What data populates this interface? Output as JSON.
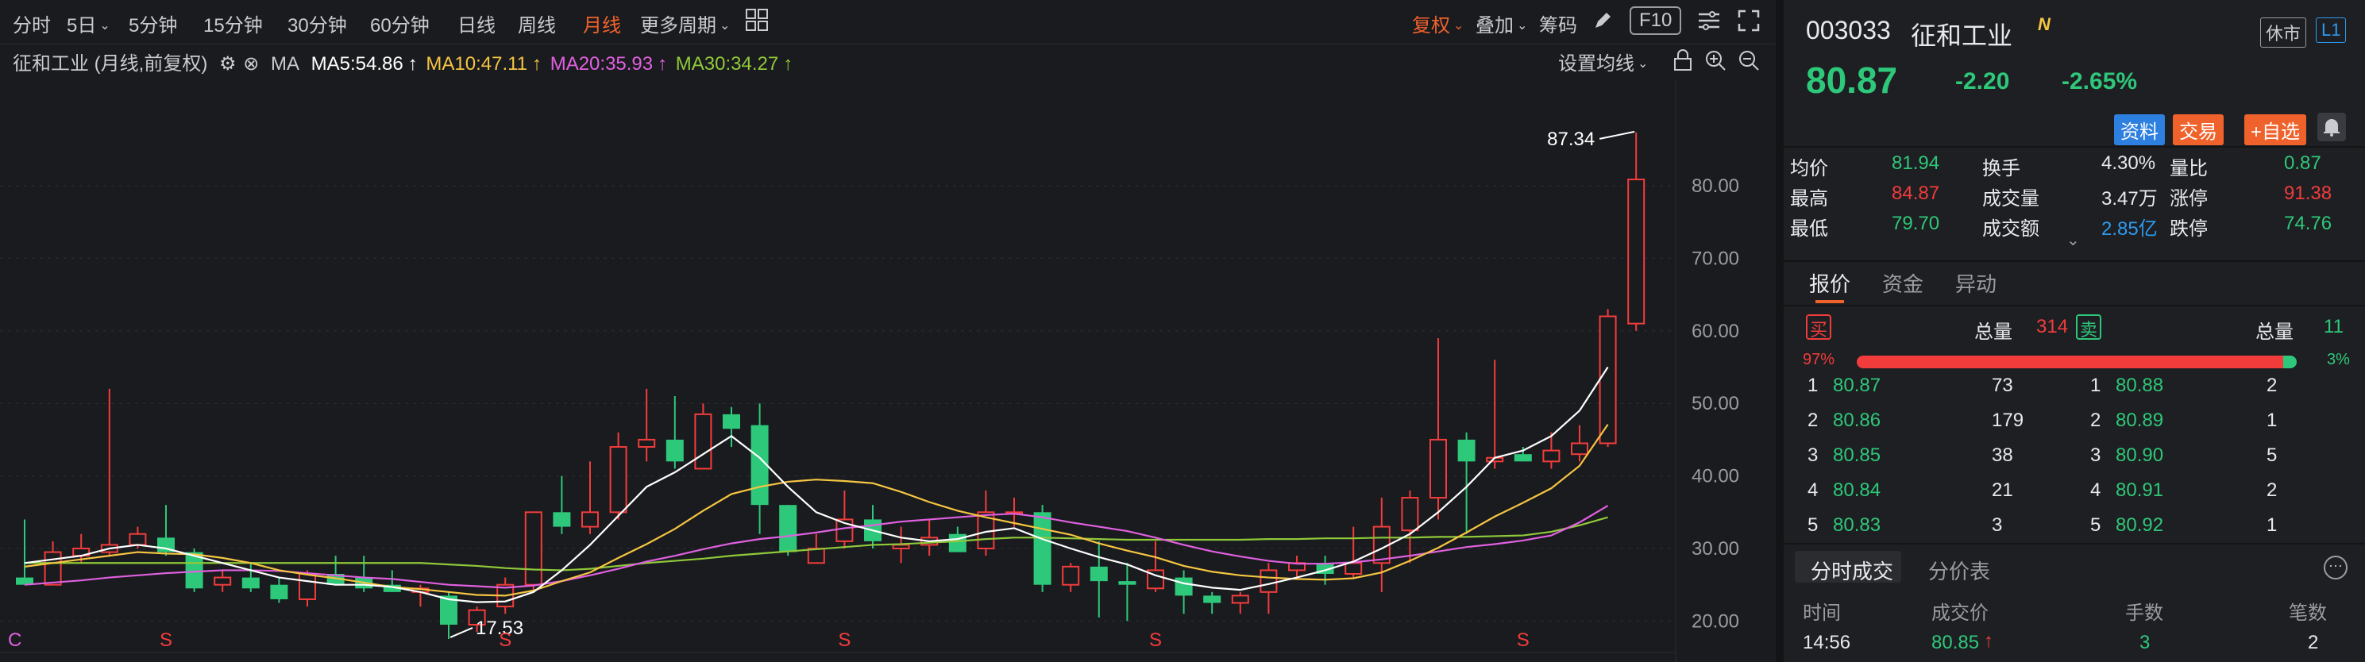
{
  "toolbar": {
    "items": [
      "分时",
      "5日",
      "5分钟",
      "15分钟",
      "30分钟",
      "60分钟",
      "日线",
      "周线",
      "月线",
      "更多周期"
    ],
    "fuquan": "复权",
    "overlay": "叠加",
    "chips": "筹码",
    "f10": "F10"
  },
  "ma_header": {
    "name": "征和工业 (月线,前复权)",
    "ma_label": "MA",
    "ma5": "MA5:54.86",
    "ma10": "MA10:47.11",
    "ma20": "MA20:35.93",
    "ma30": "MA30:34.27",
    "arrow": "↑",
    "set_ma": "设置均线",
    "colors": {
      "ma5": "#ffffff",
      "ma10": "#f5c542",
      "ma20": "#e060e0",
      "ma30": "#8fc93a"
    }
  },
  "chart_data": {
    "type": "candlestick",
    "ylim": [
      15,
      95
    ],
    "y_ticks": [
      "80.00",
      "70.00",
      "60.00",
      "50.00",
      "40.00",
      "30.00",
      "20.00"
    ],
    "y_tick_values": [
      80,
      70,
      60,
      50,
      40,
      30,
      20
    ],
    "max_label": "87.34",
    "min_label": "17.53",
    "bottom_markers": [
      {
        "label": "C",
        "i": 0
      },
      {
        "label": "S",
        "i": 5
      },
      {
        "label": "S",
        "i": 17
      },
      {
        "label": "S",
        "i": 29
      },
      {
        "label": "S",
        "i": 40
      },
      {
        "label": "S",
        "i": 53
      }
    ],
    "candles": [
      {
        "o": 26,
        "h": 34,
        "l": 25,
        "c": 25
      },
      {
        "o": 25,
        "h": 31,
        "l": 25,
        "c": 29.5
      },
      {
        "o": 29,
        "h": 32,
        "l": 28,
        "c": 30
      },
      {
        "o": 29.5,
        "h": 52,
        "l": 29,
        "c": 30.5
      },
      {
        "o": 30.5,
        "h": 33,
        "l": 30,
        "c": 32
      },
      {
        "o": 31.5,
        "h": 36,
        "l": 29,
        "c": 29.5
      },
      {
        "o": 29.5,
        "h": 30,
        "l": 24,
        "c": 24.5
      },
      {
        "o": 25,
        "h": 27,
        "l": 24,
        "c": 26
      },
      {
        "o": 26,
        "h": 28,
        "l": 24,
        "c": 24.5
      },
      {
        "o": 25,
        "h": 26,
        "l": 22.5,
        "c": 23
      },
      {
        "o": 23,
        "h": 27,
        "l": 22,
        "c": 26.5
      },
      {
        "o": 26.5,
        "h": 29,
        "l": 25,
        "c": 25
      },
      {
        "o": 26,
        "h": 29,
        "l": 24,
        "c": 24.5
      },
      {
        "o": 25,
        "h": 27,
        "l": 24,
        "c": 24
      },
      {
        "o": 24,
        "h": 25,
        "l": 22,
        "c": 24.5
      },
      {
        "o": 23.5,
        "h": 24,
        "l": 17.53,
        "c": 19.5
      },
      {
        "o": 19.5,
        "h": 22,
        "l": 18.5,
        "c": 21.5
      },
      {
        "o": 22,
        "h": 26,
        "l": 21,
        "c": 25
      },
      {
        "o": 25,
        "h": 35,
        "l": 24,
        "c": 35
      },
      {
        "o": 35,
        "h": 40,
        "l": 32,
        "c": 33
      },
      {
        "o": 33,
        "h": 42,
        "l": 32,
        "c": 35
      },
      {
        "o": 35,
        "h": 46,
        "l": 34,
        "c": 44
      },
      {
        "o": 44,
        "h": 52,
        "l": 42,
        "c": 45
      },
      {
        "o": 45,
        "h": 51,
        "l": 41,
        "c": 42
      },
      {
        "o": 41,
        "h": 50,
        "l": 41,
        "c": 48.5
      },
      {
        "o": 48.5,
        "h": 49.5,
        "l": 44,
        "c": 46.5
      },
      {
        "o": 47,
        "h": 50,
        "l": 32,
        "c": 36
      },
      {
        "o": 36,
        "h": 36,
        "l": 29,
        "c": 29.5
      },
      {
        "o": 28,
        "h": 32,
        "l": 28,
        "c": 30
      },
      {
        "o": 31,
        "h": 38,
        "l": 30,
        "c": 34
      },
      {
        "o": 34,
        "h": 36,
        "l": 30,
        "c": 31
      },
      {
        "o": 30,
        "h": 33,
        "l": 28,
        "c": 30.5
      },
      {
        "o": 30.5,
        "h": 34,
        "l": 29,
        "c": 31.5
      },
      {
        "o": 32,
        "h": 33,
        "l": 30,
        "c": 29.5
      },
      {
        "o": 30,
        "h": 38,
        "l": 29,
        "c": 35
      },
      {
        "o": 35,
        "h": 37,
        "l": 33,
        "c": 35
      },
      {
        "o": 35,
        "h": 36,
        "l": 24,
        "c": 25
      },
      {
        "o": 25,
        "h": 28,
        "l": 24,
        "c": 27.5
      },
      {
        "o": 27.5,
        "h": 31,
        "l": 20.5,
        "c": 25.5
      },
      {
        "o": 25.5,
        "h": 28,
        "l": 20,
        "c": 25
      },
      {
        "o": 24.5,
        "h": 31,
        "l": 24,
        "c": 27
      },
      {
        "o": 26,
        "h": 27,
        "l": 21,
        "c": 23.5
      },
      {
        "o": 23.5,
        "h": 24,
        "l": 21,
        "c": 22.5
      },
      {
        "o": 22.5,
        "h": 24,
        "l": 21,
        "c": 23.5
      },
      {
        "o": 24,
        "h": 28,
        "l": 21,
        "c": 27
      },
      {
        "o": 27,
        "h": 29,
        "l": 26,
        "c": 28
      },
      {
        "o": 28,
        "h": 29,
        "l": 25,
        "c": 26.5
      },
      {
        "o": 26.5,
        "h": 33,
        "l": 26,
        "c": 28
      },
      {
        "o": 28,
        "h": 37,
        "l": 24,
        "c": 33
      },
      {
        "o": 32.5,
        "h": 38,
        "l": 28,
        "c": 37
      },
      {
        "o": 37,
        "h": 59,
        "l": 34,
        "c": 45
      },
      {
        "o": 45,
        "h": 46,
        "l": 32,
        "c": 42
      },
      {
        "o": 42,
        "h": 56,
        "l": 41,
        "c": 42.5
      },
      {
        "o": 43,
        "h": 44,
        "l": 42,
        "c": 42
      },
      {
        "o": 42,
        "h": 46,
        "l": 41,
        "c": 43.5
      },
      {
        "o": 43,
        "h": 47,
        "l": 42,
        "c": 44.5
      },
      {
        "o": 44.5,
        "h": 63,
        "l": 44,
        "c": 62
      },
      {
        "o": 61,
        "h": 87.34,
        "l": 60,
        "c": 80.87
      }
    ],
    "ma5": [
      28,
      28.5,
      29,
      30,
      30.5,
      30,
      29,
      28,
      27,
      26,
      25.5,
      25,
      25,
      24.7,
      24,
      23,
      22.6,
      22.7,
      24,
      27,
      30.5,
      34.5,
      38.5,
      40.5,
      43,
      45.5,
      42.5,
      38.5,
      35,
      33.5,
      32.5,
      31.5,
      31,
      31.3,
      32.3,
      32.8,
      31.3,
      30,
      28.8,
      27.8,
      26.3,
      25.2,
      24.6,
      24.3,
      25.1,
      26,
      27,
      28.2,
      30,
      32,
      35,
      38.5,
      42.5,
      43.5,
      45.5,
      49,
      55
    ],
    "ma10": [
      27.5,
      28,
      28.5,
      29,
      29.5,
      29.3,
      29.2,
      28.7,
      28,
      27,
      26.4,
      25.9,
      25.3,
      24.7,
      24.4,
      24,
      23.6,
      23.5,
      24.2,
      25.5,
      26.7,
      28.7,
      30.6,
      32.7,
      35.2,
      37.5,
      38.5,
      39.2,
      39.5,
      39.3,
      39,
      37.8,
      36.4,
      35.2,
      34.3,
      33.5,
      32.7,
      31.9,
      30.7,
      29.7,
      28.8,
      27.6,
      26.8,
      26.3,
      26,
      25.8,
      25.7,
      25.9,
      26.7,
      28.3,
      30.1,
      32.2,
      34.4,
      36.3,
      38.3,
      41.4,
      47.1
    ],
    "ma20": [
      25,
      25.3,
      25.6,
      26,
      26.3,
      26.6,
      26.8,
      27,
      27,
      26.9,
      26.6,
      26.3,
      26,
      25.8,
      25.4,
      25,
      24.8,
      24.6,
      24.9,
      25.5,
      26.3,
      27.2,
      28.2,
      29,
      29.9,
      30.7,
      31.3,
      31.7,
      32.2,
      32.8,
      33.2,
      33.7,
      34,
      34.3,
      34.6,
      34.8,
      34.3,
      33.6,
      33,
      32.4,
      31.5,
      30.5,
      29.6,
      28.9,
      28.3,
      27.9,
      27.9,
      28.1,
      28.5,
      29,
      29.6,
      30.2,
      30.6,
      31.1,
      31.8,
      33.6,
      35.9
    ],
    "ma30": [
      28,
      28,
      28,
      28,
      28,
      28,
      28,
      28,
      28,
      28,
      28,
      28,
      28,
      28,
      28,
      27.8,
      27.6,
      27.3,
      27.1,
      27,
      27.2,
      27.6,
      28,
      28.3,
      28.6,
      29,
      29.3,
      29.6,
      29.9,
      30.2,
      30.5,
      30.6,
      30.8,
      31,
      31.3,
      31.5,
      31.5,
      31.4,
      31.3,
      31.2,
      31.2,
      31.2,
      31.2,
      31.2,
      31.3,
      31.3,
      31.4,
      31.4,
      31.5,
      31.5,
      31.6,
      31.6,
      31.7,
      31.8,
      32.3,
      33.2,
      34.3
    ]
  },
  "quote": {
    "code": "003033",
    "name": "征和工业",
    "n_badge": "N",
    "status": "休市",
    "level": "L1",
    "price": "80.87",
    "change": "-2.20",
    "change_pct": "-2.65%",
    "btn_info": "资料",
    "btn_trade": "交易",
    "btn_watch": "+自选",
    "stats": [
      [
        {
          "k": "均价",
          "v": "81.94",
          "c": "green"
        },
        {
          "k": "换手",
          "v": "4.30%",
          "c": "white"
        },
        {
          "k": "量比",
          "v": "0.87",
          "c": "green"
        }
      ],
      [
        {
          "k": "最高",
          "v": "84.87",
          "c": "red"
        },
        {
          "k": "成交量",
          "v": "3.47万",
          "c": "white"
        },
        {
          "k": "涨停",
          "v": "91.38",
          "c": "red"
        }
      ],
      [
        {
          "k": "最低",
          "v": "79.70",
          "c": "green"
        },
        {
          "k": "成交额",
          "v": "2.85亿",
          "c": "blue"
        },
        {
          "k": "跌停",
          "v": "74.76",
          "c": "green"
        }
      ]
    ],
    "more_caret": "⌄"
  },
  "tabs1": [
    "报价",
    "资金",
    "异动"
  ],
  "orderbook": {
    "buy_label": "买",
    "sell_label": "卖",
    "total_label": "总量",
    "buy_total": "314",
    "sell_total": "11",
    "buy_pct": "97%",
    "sell_pct": "3%",
    "buy_ratio": 0.97,
    "buys": [
      [
        "1",
        "80.87",
        "73"
      ],
      [
        "2",
        "80.86",
        "179"
      ],
      [
        "3",
        "80.85",
        "38"
      ],
      [
        "4",
        "80.84",
        "21"
      ],
      [
        "5",
        "80.83",
        "3"
      ]
    ],
    "sells": [
      [
        "1",
        "80.88",
        "2"
      ],
      [
        "2",
        "80.89",
        "1"
      ],
      [
        "3",
        "80.90",
        "5"
      ],
      [
        "4",
        "80.91",
        "2"
      ],
      [
        "5",
        "80.92",
        "1"
      ]
    ]
  },
  "tabs2": [
    "分时成交",
    "分价表"
  ],
  "trades": {
    "headers": [
      "时间",
      "成交价",
      "手数",
      "笔数"
    ],
    "rows": [
      [
        "14:56",
        "80.85",
        "3",
        "2"
      ]
    ]
  }
}
